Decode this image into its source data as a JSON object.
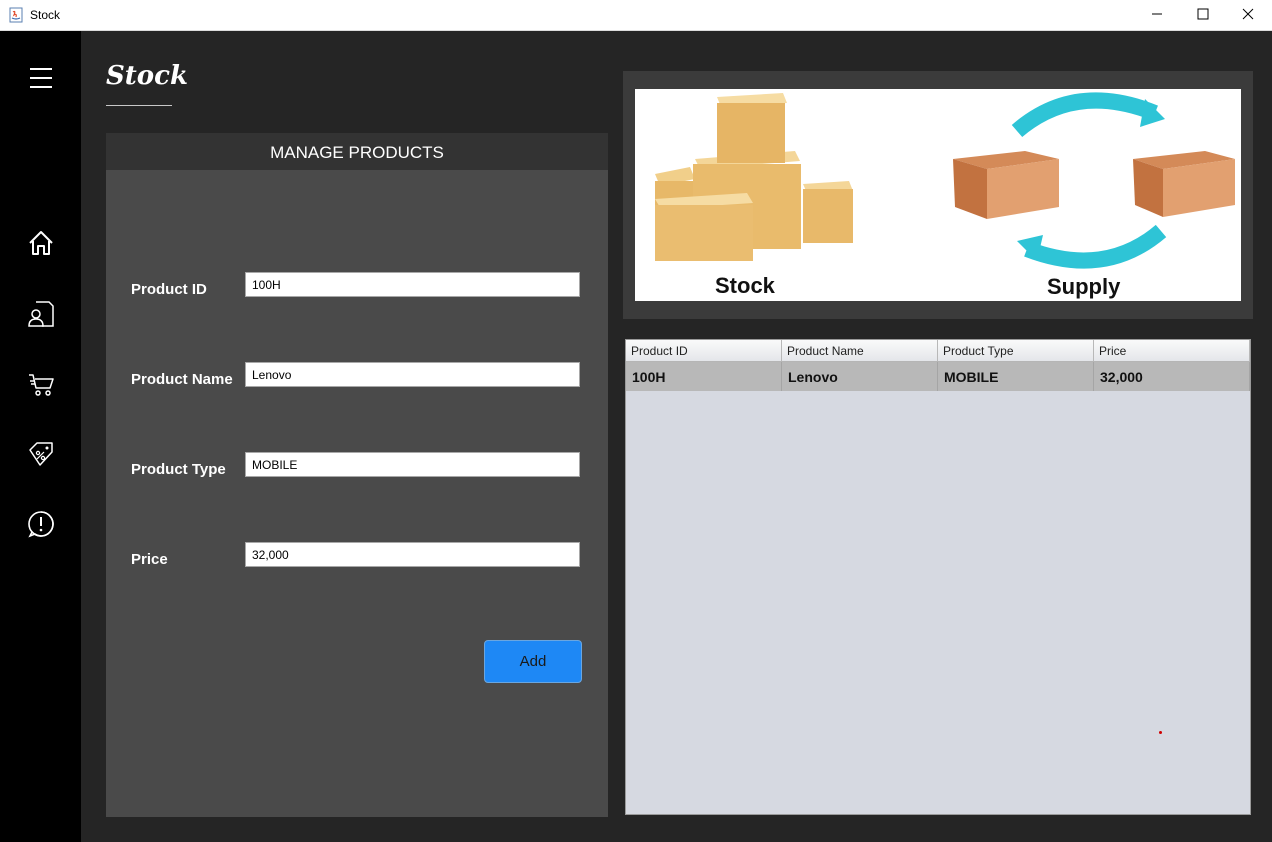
{
  "window": {
    "title": "Stock"
  },
  "sidebar": {
    "items": [
      {
        "icon": "menu-icon"
      },
      {
        "icon": "home-icon"
      },
      {
        "icon": "customer-document-icon"
      },
      {
        "icon": "cart-icon"
      },
      {
        "icon": "discount-tag-icon"
      },
      {
        "icon": "alert-icon"
      }
    ]
  },
  "page": {
    "title": "Stock"
  },
  "manage": {
    "header": "MANAGE PRODUCTS",
    "product_id_label": "Product ID",
    "product_id_value": "100H",
    "product_name_label": "Product Name",
    "product_name_value": "Lenovo",
    "product_type_label": "Product Type",
    "product_type_value": "MOBILE",
    "price_label": "Price",
    "price_value": "32,000",
    "add_label": "Add"
  },
  "banner": {
    "left_label": "Stock",
    "right_label": "Supply"
  },
  "table": {
    "columns": [
      "Product ID",
      "Product Name",
      "Product Type",
      "Price"
    ],
    "rows": [
      [
        "100H",
        "Lenovo",
        "MOBILE",
        "32,000"
      ]
    ]
  },
  "colors": {
    "accent": "#1e88f5",
    "panel": "#4a4a4a",
    "sidebar": "#000000",
    "arrow": "#2ec4d6",
    "box": "#e8b96a"
  }
}
